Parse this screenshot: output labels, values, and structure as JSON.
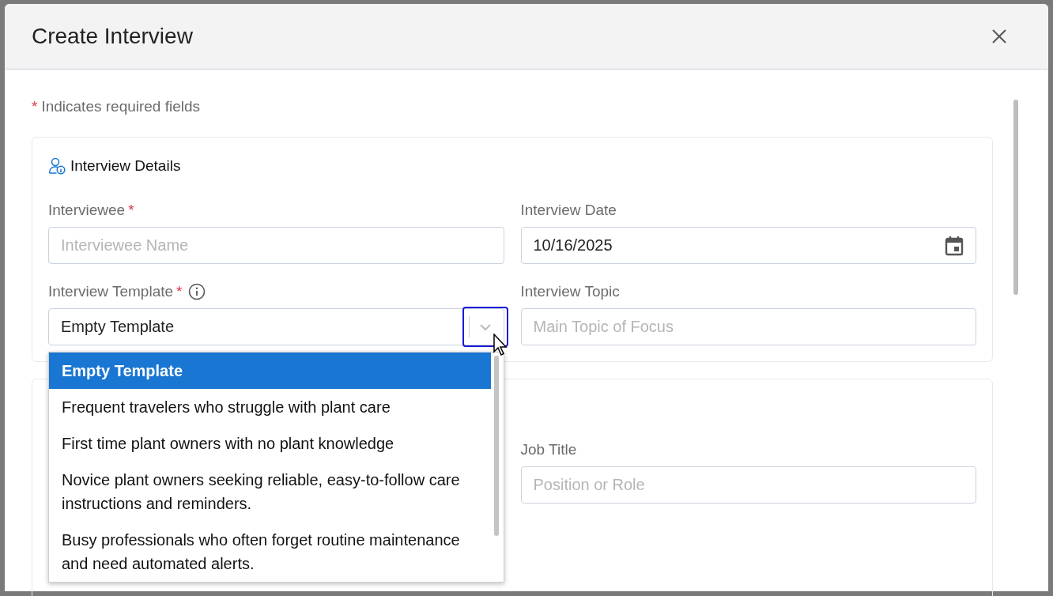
{
  "dialog": {
    "title": "Create Interview",
    "required_mark": "*",
    "required_note": {
      "mark": "*",
      "text": "Indicates required fields"
    },
    "sections": [
      {
        "title": "Interview Details",
        "fields": [
          {
            "label": "Interviewee",
            "required": true,
            "kind": "text",
            "placeholder": "Interviewee Name"
          },
          {
            "label": "Interview Date",
            "kind": "date",
            "value": "10/16/2025"
          },
          {
            "label": "Interview Template",
            "required": true,
            "info": true,
            "kind": "select",
            "value": "Empty Template",
            "open": true
          },
          {
            "label": "Interview Topic",
            "kind": "text",
            "placeholder": "Main Topic of Focus"
          }
        ]
      },
      {
        "fields": [
          {
            "kind": "hidden"
          },
          {
            "label": "Job Title",
            "kind": "text",
            "placeholder": "Position or Role"
          }
        ]
      }
    ],
    "dropdown": {
      "options": [
        {
          "label": "Empty Template",
          "selected": true
        },
        {
          "label": "Frequent travelers who struggle with plant care",
          "selected": false
        },
        {
          "label": "First time plant owners with no plant knowledge",
          "selected": false
        },
        {
          "label": "Novice plant owners seeking reliable, easy-to-follow care instructions and reminders.",
          "selected": false
        },
        {
          "label": "Busy professionals who often forget routine maintenance and need automated alerts.",
          "selected": false
        }
      ]
    }
  }
}
